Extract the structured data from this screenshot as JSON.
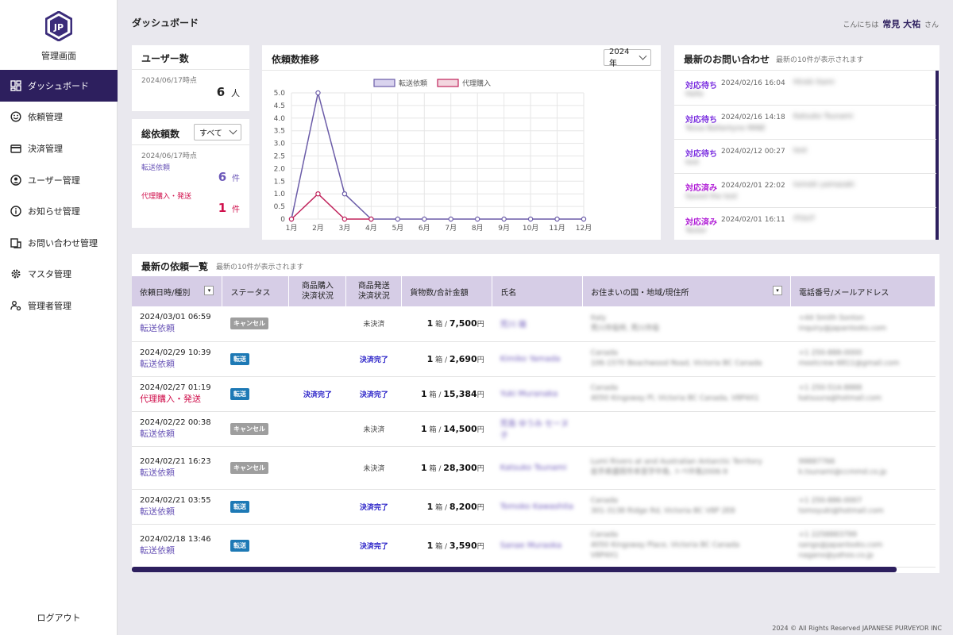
{
  "brand": "管理画面",
  "nav": [
    {
      "label": "ダッシュボード",
      "icon": "dashboard-icon",
      "active": true
    },
    {
      "label": "依頼管理",
      "icon": "smile-icon"
    },
    {
      "label": "決済管理",
      "icon": "card-icon"
    },
    {
      "label": "ユーザー管理",
      "icon": "user-circle-icon"
    },
    {
      "label": "お知らせ管理",
      "icon": "info-icon"
    },
    {
      "label": "お問い合わせ管理",
      "icon": "inquiry-icon"
    },
    {
      "label": "マスタ管理",
      "icon": "gear-icon"
    },
    {
      "label": "管理者管理",
      "icon": "admin-icon"
    }
  ],
  "logout": "ログアウト",
  "header": {
    "title": "ダッシュボード",
    "greeting_prefix": "こんにちは",
    "user_name": "常見 大祐",
    "greeting_suffix": "さん"
  },
  "users_card": {
    "title": "ユーザー数",
    "date": "2024/06/17時点",
    "count": "6",
    "unit": "人"
  },
  "total_card": {
    "title": "総依頼数",
    "filter": "すべて",
    "date": "2024/06/17時点",
    "transfer_label": "転送依頼",
    "transfer_count": "6",
    "proxy_label": "代理購入・発送",
    "proxy_count": "1",
    "unit": "件"
  },
  "chart_card": {
    "title": "依頼数推移",
    "year": "2024年"
  },
  "chart_data": {
    "type": "line",
    "categories": [
      "1月",
      "2月",
      "3月",
      "4月",
      "5月",
      "6月",
      "7月",
      "8月",
      "9月",
      "10月",
      "11月",
      "12月"
    ],
    "ylim": [
      0,
      5
    ],
    "yticks": [
      "0",
      "0.5",
      "1.0",
      "1.5",
      "2.0",
      "2.5",
      "3.0",
      "3.5",
      "4.0",
      "4.5",
      "5.0"
    ],
    "series": [
      {
        "name": "転送依頼",
        "color": "#6b5ca8",
        "fill": "#d9d3ee",
        "values": [
          0,
          5,
          1,
          0,
          0,
          0,
          0,
          0,
          0,
          0,
          0,
          0
        ]
      },
      {
        "name": "代理購入",
        "color": "#c0245c",
        "fill": "#f3d6df",
        "values": [
          0,
          1,
          0,
          0,
          null,
          null,
          null,
          null,
          null,
          null,
          null,
          null
        ]
      }
    ],
    "grid": true,
    "legend": "top-center"
  },
  "inquiries_card": {
    "title": "最新のお問い合わせ",
    "note": "最新の10件が表示されます",
    "items": [
      {
        "status": "対応待ち",
        "date": "2024/02/16 16:04",
        "name": "Hiroki Itami",
        "text": "Hello"
      },
      {
        "status": "対応待ち",
        "date": "2024/02/16 14:18",
        "name": "Katsuko Tsunami",
        "text": "Tessa Ballantyne MINE"
      },
      {
        "status": "対応待ち",
        "date": "2024/02/12 00:27",
        "name": "test",
        "text": "test"
      },
      {
        "status": "対応済み",
        "date": "2024/02/01 22:02",
        "name": "tomoki yamazaki",
        "text": "Saved the test"
      },
      {
        "status": "対応済み",
        "date": "2024/02/01 16:11",
        "name": "ITOUT",
        "text": "Tester"
      }
    ]
  },
  "requests_card": {
    "title": "最新の依頼一覧",
    "note": "最新の10件が表示されます",
    "columns": [
      "依頼日時/種別",
      "ステータス",
      "商品購入\n決済状況",
      "商品発送\n決済状況",
      "貨物数/合計金額",
      "氏名",
      "お住まいの国・地域/現住所",
      "電話番号/メールアドレス"
    ],
    "box_unit": "箱",
    "yen_unit": "円",
    "rows": [
      {
        "date": "2024/03/01 06:59",
        "type": "転送依頼",
        "kind": "t",
        "status": "キャンセル",
        "status_kind": "cancel",
        "purchase": "",
        "shipping": "未決済",
        "ship_paid": false,
        "boxes": "1",
        "amount": "7,500",
        "name": "荒川 雄",
        "address": "Italy\n荒川市役所, 荒川市役",
        "contact": "+44 Smith Sonton\ninquiry@japanlooks.com"
      },
      {
        "date": "2024/02/29 10:39",
        "type": "転送依頼",
        "kind": "t",
        "status": "転送",
        "status_kind": "transfer",
        "purchase": "",
        "shipping": "決済完了",
        "ship_paid": true,
        "boxes": "1",
        "amount": "2,690",
        "name": "Kimiko Yamada",
        "address": "Canada\n106-1570 Beachwood Road, Victoria BC Canada",
        "contact": "+1 250-888-0000\nmeetcrew-6811@gmail.com"
      },
      {
        "date": "2024/02/27 01:19",
        "type": "代理購入・発送",
        "kind": "p",
        "status": "転送",
        "status_kind": "transfer",
        "purchase": "決済完了",
        "shipping": "決済完了",
        "ship_paid": true,
        "boxes": "1",
        "amount": "15,384",
        "name": "Yuki Muranaka",
        "address": "Canada\n4050 Kingsway Pl, Victoria BC Canada, V8P4X1",
        "contact": "+1 250-514-8888\nkatsuura@hotmail.com"
      },
      {
        "date": "2024/02/22 00:38",
        "type": "転送依頼",
        "kind": "t",
        "status": "キャンセル",
        "status_kind": "cancel",
        "purchase": "",
        "shipping": "未決済",
        "ship_paid": false,
        "boxes": "1",
        "amount": "14,500",
        "name": "荒島 ゆうみ セーヌ 子",
        "address": "",
        "contact": ""
      },
      {
        "date": "2024/02/21 16:23",
        "type": "転送依頼",
        "kind": "t",
        "status": "キャンセル",
        "status_kind": "cancel",
        "purchase": "",
        "shipping": "未決済",
        "ship_paid": false,
        "boxes": "1",
        "amount": "28,300",
        "name": "Katsuko Tsunami",
        "address": "Lumi Rivers at and Australian Antarctic Territory\n岩手県盛岡市本宮字中島, トペ中島2006-9",
        "contact": "99887766\nk.tsunami@ccmmd.co.jp"
      },
      {
        "date": "2024/02/21 03:55",
        "type": "転送依頼",
        "kind": "t",
        "status": "転送",
        "status_kind": "transfer",
        "purchase": "",
        "shipping": "決済完了",
        "ship_paid": true,
        "boxes": "1",
        "amount": "8,200",
        "name": "Tomoko Kawashita",
        "address": "Canada\n301-3138 Ridge Rd, Victoria BC V8P 2E8",
        "contact": "+1 250-886-0007\ntomoyuki@hotmail.com"
      },
      {
        "date": "2024/02/18 13:46",
        "type": "転送依頼",
        "kind": "t",
        "status": "転送",
        "status_kind": "transfer",
        "purchase": "",
        "shipping": "決済完了",
        "ship_paid": true,
        "boxes": "1",
        "amount": "3,590",
        "name": "Sanae Muraoka",
        "address": "Canada\n4050 Kingsway Place, Victoria BC Canada\nV8P4X1",
        "contact": "+1 2258883799\nsangs@japanlooks.com\nnagano@yahoo.co.jp"
      }
    ]
  },
  "footer": "2024 © All Rights Reserved JAPANESE PURVEYOR INC"
}
